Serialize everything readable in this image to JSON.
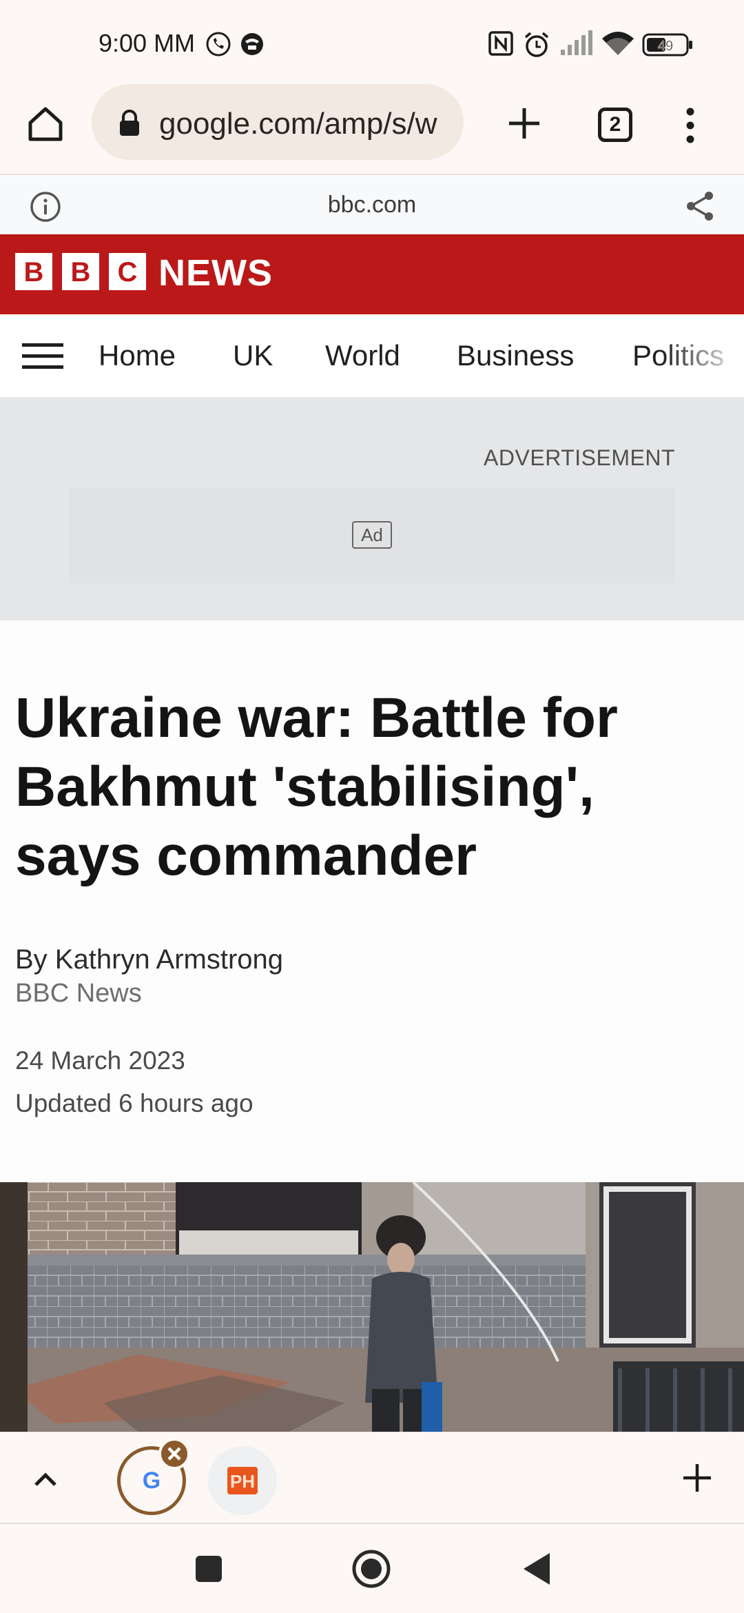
{
  "status_bar": {
    "time": "9:00 MM",
    "battery": "49"
  },
  "browser": {
    "url": "google.com/amp/s/w",
    "tab_count": "2"
  },
  "domain_bar": {
    "domain": "bbc.com"
  },
  "bbc_header": {
    "logo_letters": [
      "B",
      "B",
      "C"
    ],
    "news_label": "NEWS"
  },
  "nav": {
    "items": [
      "Home",
      "UK",
      "World",
      "Business",
      "Politics"
    ]
  },
  "ad": {
    "label": "ADVERTISEMENT",
    "badge": "Ad"
  },
  "article": {
    "headline": "Ukraine war: Battle for Bakhmut 'stabilising', says commander",
    "author": "By Kathryn Armstrong",
    "organisation": "BBC News",
    "date": "24 March 2023",
    "updated": "Updated 6 hours ago"
  },
  "tab_strip": {
    "google_glyph": "G",
    "ph_glyph": "PH"
  },
  "colors": {
    "bbc_red": "#bb1919",
    "tab_accent": "#8a5a2b",
    "browser_bg": "#fdf8f5"
  },
  "icons": {
    "status_bar": [
      "phone-call-icon",
      "vpn-icon",
      "nfc-icon",
      "alarm-icon",
      "signal-icon",
      "wifi-icon",
      "battery-icon"
    ],
    "toolbar": [
      "home-icon",
      "lock-icon",
      "plus-icon",
      "tab-switcher-icon",
      "more-vert-icon"
    ],
    "domain_bar": [
      "info-icon",
      "share-icon"
    ],
    "bottom": [
      "chevron-up-icon",
      "close-icon",
      "plus-icon",
      "square-icon",
      "circle-icon",
      "back-triangle-icon"
    ]
  }
}
